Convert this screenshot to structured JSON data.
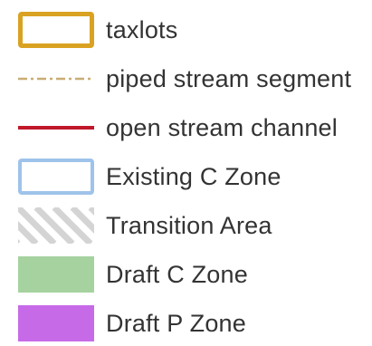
{
  "legend": {
    "items": [
      {
        "id": "taxlots",
        "label": "taxlots",
        "symbol": "outlined-rectangle",
        "color": "#d9a222"
      },
      {
        "id": "piped",
        "label": "piped stream segment",
        "symbol": "dash-dot-line",
        "color": "#c9ad74"
      },
      {
        "id": "open",
        "label": "open stream channel",
        "symbol": "solid-line",
        "color": "#c0182a"
      },
      {
        "id": "existing",
        "label": "Existing C Zone",
        "symbol": "outlined-rectangle",
        "color": "#9fc3ea"
      },
      {
        "id": "transition",
        "label": "Transition Area",
        "symbol": "diagonal-hatch",
        "color": "#d4d4d4"
      },
      {
        "id": "draft_c",
        "label": "Draft C Zone",
        "symbol": "filled-rectangle",
        "color": "#a6d2a0"
      },
      {
        "id": "draft_p",
        "label": "Draft P Zone",
        "symbol": "filled-rectangle",
        "color": "#c76ae8"
      }
    ]
  }
}
